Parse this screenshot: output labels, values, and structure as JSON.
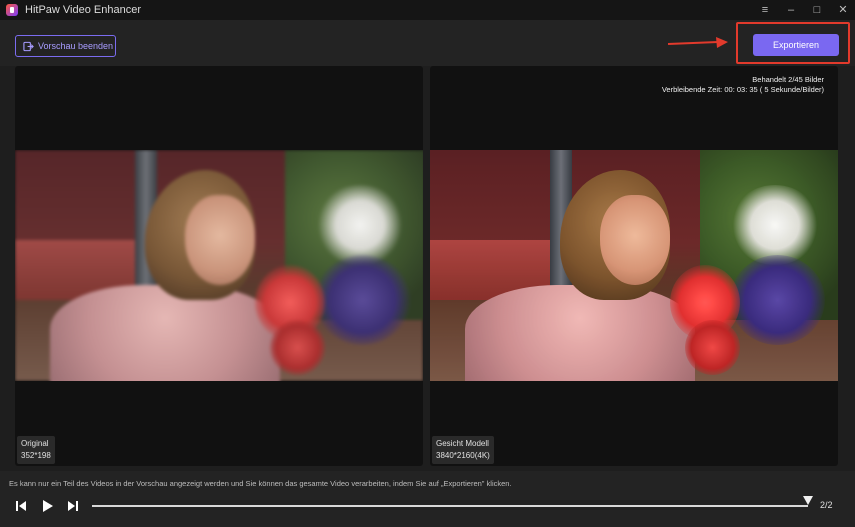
{
  "window": {
    "title": "HitPaw Video Enhancer",
    "controls": {
      "menu": "≡",
      "minimize": "–",
      "maximize": "□",
      "close": "✕"
    }
  },
  "toolbar": {
    "end_preview_label": "Vorschau beenden",
    "export_label": "Exportieren"
  },
  "preview": {
    "left": {
      "name": "Original",
      "resolution": "352*198"
    },
    "right": {
      "name": "Gesicht Modell",
      "resolution": "3840*2160(4K)",
      "progress_line1": "Behandelt 2/45 Bilder",
      "progress_line2": "Verbleibende Zeit: 00: 03: 35 ( 5 Sekunde/Bilder)"
    }
  },
  "bottom": {
    "hint": "Es kann nur ein Teil des Videos in der Vorschau angezeigt werden und Sie können das gesamte Video verarbeiten, indem Sie auf „Exportieren\" klicken.",
    "page_count": "2/2",
    "timeline_progress": 1.0
  },
  "colors": {
    "accent": "#7a68f1",
    "highlight": "#e23a2c",
    "background": "#1e1e1e"
  }
}
